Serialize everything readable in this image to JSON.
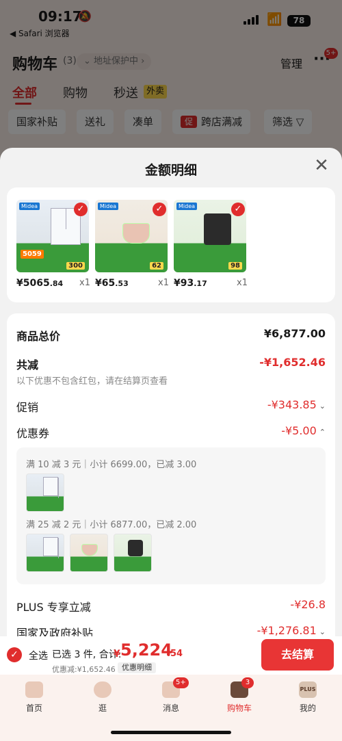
{
  "status": {
    "time": "09:17",
    "back_app": "◀ Safari 浏览器",
    "battery": "78"
  },
  "header": {
    "title": "购物车",
    "count": "(3)",
    "address": "⌄ 地址保护中 ›",
    "manage": "管理",
    "more": "···",
    "more_badge": "5+"
  },
  "tabs": [
    {
      "label": "全部",
      "active": true
    },
    {
      "label": "购物",
      "active": false
    },
    {
      "label": "秒送",
      "active": false
    }
  ],
  "wai_badge": "外卖",
  "chips": [
    "国家补贴",
    "送礼",
    "凑单",
    "跨店满减",
    "筛选 ▽"
  ],
  "chip_icon": "促",
  "sheet": {
    "title": "金额明细",
    "close": "✕",
    "products": [
      {
        "price_main": "¥5065",
        "price_dec": ".84",
        "qty": "x1",
        "img": "fridge",
        "brand": "Midea",
        "tag1": "5059",
        "tag2": "300"
      },
      {
        "price_main": "¥65",
        "price_dec": ".53",
        "qty": "x1",
        "img": "chopper",
        "brand": "Midea",
        "tag1": "",
        "tag2": "62"
      },
      {
        "price_main": "¥93",
        "price_dec": ".17",
        "qty": "x1",
        "img": "coffee",
        "brand": "Midea",
        "tag1": "",
        "tag2": "98"
      }
    ],
    "rows": {
      "goods_total_label": "商品总价",
      "goods_total": "¥6,877.00",
      "reduce_label": "共减",
      "reduce": "-¥1,652.46",
      "reduce_note": "以下优惠不包含红包，请在结算页查看",
      "promo_label": "促销",
      "promo": "-¥343.85",
      "coupon_label": "优惠券",
      "coupon": "-¥5.00",
      "coupon_line1": "满 10 减 3 元｜小计 6699.00，已减 3.00",
      "coupon_line2": "满 25 减 2 元｜小计 6877.00，已减 2.00",
      "plus_label": "PLUS 专享立减",
      "plus": "-¥26.8",
      "gov_label": "国家及政府补贴",
      "gov": "-¥1,276.81"
    }
  },
  "checkout": {
    "select_all": "全选",
    "selected": "已选 3 件, 合计:",
    "total_symbol": "¥",
    "total_int": "5,224",
    "total_dec": ".54",
    "discount": "优惠减:¥1,652.46",
    "detail_link": "优惠明细",
    "pay": "去结算"
  },
  "tabbar": [
    {
      "label": "首页",
      "icon": "home-icon",
      "badge": ""
    },
    {
      "label": "逛",
      "icon": "browse-icon",
      "badge": ""
    },
    {
      "label": "消息",
      "icon": "message-icon",
      "badge": "5+"
    },
    {
      "label": "购物车",
      "icon": "cart-icon",
      "badge": "3",
      "active": true
    },
    {
      "label": "我的",
      "icon": "plus-icon",
      "badge": ""
    }
  ],
  "tabbar_plus_text": "PLUS",
  "colors": {
    "accent": "#e02d2d",
    "pay_button": "#e83535"
  }
}
